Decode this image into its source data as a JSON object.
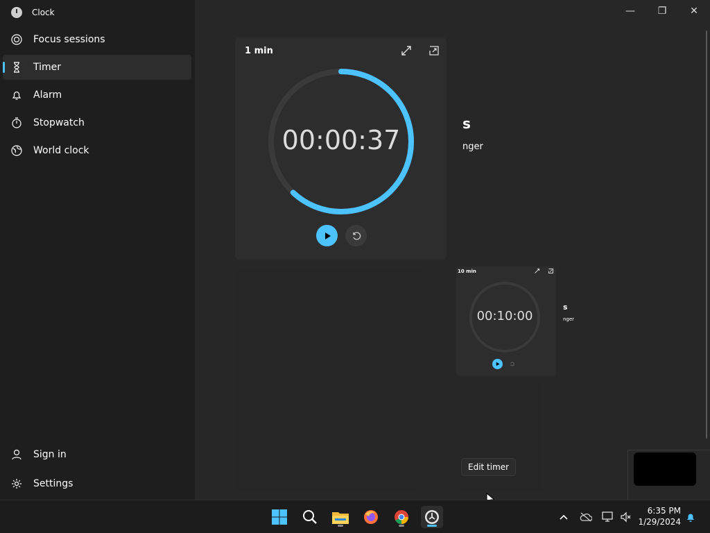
{
  "app": {
    "title": "Clock"
  },
  "window_controls": {
    "minimize": "—",
    "maximize": "❐",
    "close": "✕"
  },
  "sidebar": {
    "items": [
      {
        "label": "Focus sessions",
        "icon": "focus-icon"
      },
      {
        "label": "Timer",
        "icon": "hourglass-icon",
        "active": true
      },
      {
        "label": "Alarm",
        "icon": "bell-icon"
      },
      {
        "label": "Stopwatch",
        "icon": "stopwatch-icon"
      },
      {
        "label": "World clock",
        "icon": "globe-icon"
      }
    ],
    "bottom": [
      {
        "label": "Sign in",
        "icon": "user-icon"
      },
      {
        "label": "Settings",
        "icon": "gear-icon"
      }
    ]
  },
  "timer_main": {
    "title": "1 min",
    "time": "00:00:37",
    "progress": 0.62
  },
  "timer_small": {
    "title": "10 min",
    "time": "00:10:00",
    "progress": 0
  },
  "partial_text": {
    "large_heading": "s",
    "large_sub": "nger",
    "small_heading": "s",
    "small_sub": "nger"
  },
  "tooltip": {
    "text": "Edit timer"
  },
  "taskbar": {
    "apps": [
      "windows-start-icon",
      "search-icon",
      "file-explorer-icon",
      "firefox-icon",
      "chrome-icon",
      "clock-app-icon"
    ]
  },
  "system_tray": {
    "time": "6:35 PM",
    "date": "1/29/2024"
  },
  "colors": {
    "accent": "#4cc2ff",
    "background": "#202020",
    "card": "#2d2d2d"
  }
}
